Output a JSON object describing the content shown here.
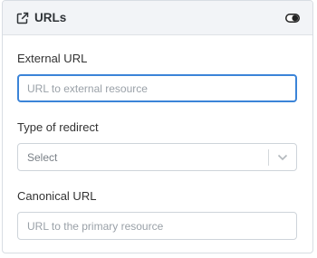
{
  "header": {
    "title": "URLs",
    "icon": "external-link-icon",
    "toggle_icon": "toggle-icon"
  },
  "fields": {
    "external_url": {
      "label": "External URL",
      "value": "",
      "placeholder": "URL to external resource"
    },
    "redirect_type": {
      "label": "Type of redirect",
      "selected": "Select"
    },
    "canonical_url": {
      "label": "Canonical URL",
      "value": "",
      "placeholder": "URL to the primary resource"
    }
  },
  "colors": {
    "focus_border": "#3b84d8",
    "header_bg": "#f2f4f7"
  }
}
